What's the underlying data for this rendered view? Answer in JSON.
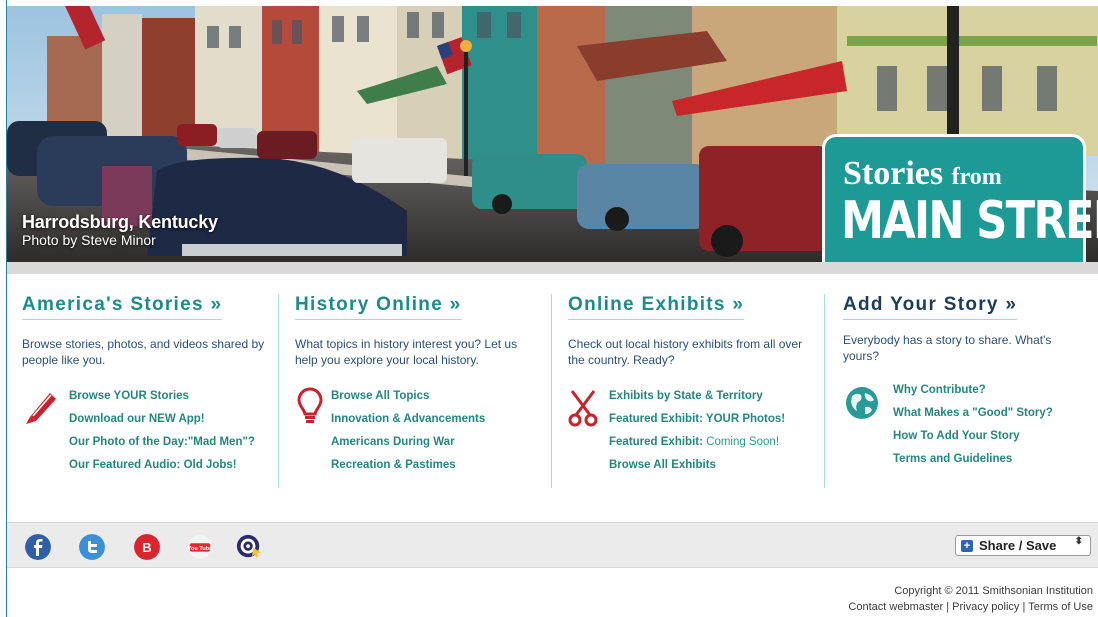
{
  "hero": {
    "caption_place": "Harrodsburg, Kentucky",
    "caption_credit": "Photo by Steve Minor",
    "logo_line1_a": "Stories",
    "logo_line1_b": "from",
    "logo_line2": "MAIN STREET"
  },
  "columns": [
    {
      "title": "America's Stories »",
      "description": "Browse stories, photos, and videos shared by people like you.",
      "icon": "pencil-icon",
      "links": [
        "Browse YOUR Stories",
        "Download our NEW App!",
        "Our Photo of the Day:\"Mad Men\"?",
        "Our Featured Audio: Old Jobs!"
      ]
    },
    {
      "title": "History Online »",
      "description": "What topics in history interest you? Let us help you explore your local history.",
      "icon": "lightbulb-icon",
      "links": [
        "Browse All Topics",
        "Innovation & Advancements",
        "Americans During War",
        "Recreation & Pastimes"
      ]
    },
    {
      "title": "Online Exhibits »",
      "description": "Check out local history exhibits from all over the country. Ready?",
      "icon": "scissors-icon",
      "links": [
        "Exhibits by State & Territory",
        "Featured Exhibit: YOUR Photos!",
        "Featured Exhibit:",
        "Browse All Exhibits"
      ],
      "link3_suffix": "Coming Soon!"
    },
    {
      "title": "Add Your Story »",
      "description": "Everybody has a story to share. What's yours?",
      "icon": "globe-icon",
      "links": [
        "Why Contribute?",
        "What Makes a \"Good\" Story?",
        "How To Add Your Story",
        "Terms and Guidelines"
      ]
    }
  ],
  "social": {
    "icons": [
      "facebook-icon",
      "twitter-icon",
      "blogger-icon",
      "youtube-icon",
      "target-icon"
    ],
    "youtube_text": "You Tube",
    "blogger_text": "B",
    "share_label": "Share / Save",
    "share_arrows": "⬍"
  },
  "footer": {
    "copyright": "Copyright © 2011  Smithsonian Institution",
    "contact": "Contact webmaster",
    "privacy": "Privacy policy",
    "terms": "Terms of Use",
    "separator": "|"
  },
  "colors": {
    "teal_heading": "#1e8a8a",
    "dark_heading": "#1d3d56",
    "link": "#24867f",
    "logo_bg": "#1e9a96"
  }
}
